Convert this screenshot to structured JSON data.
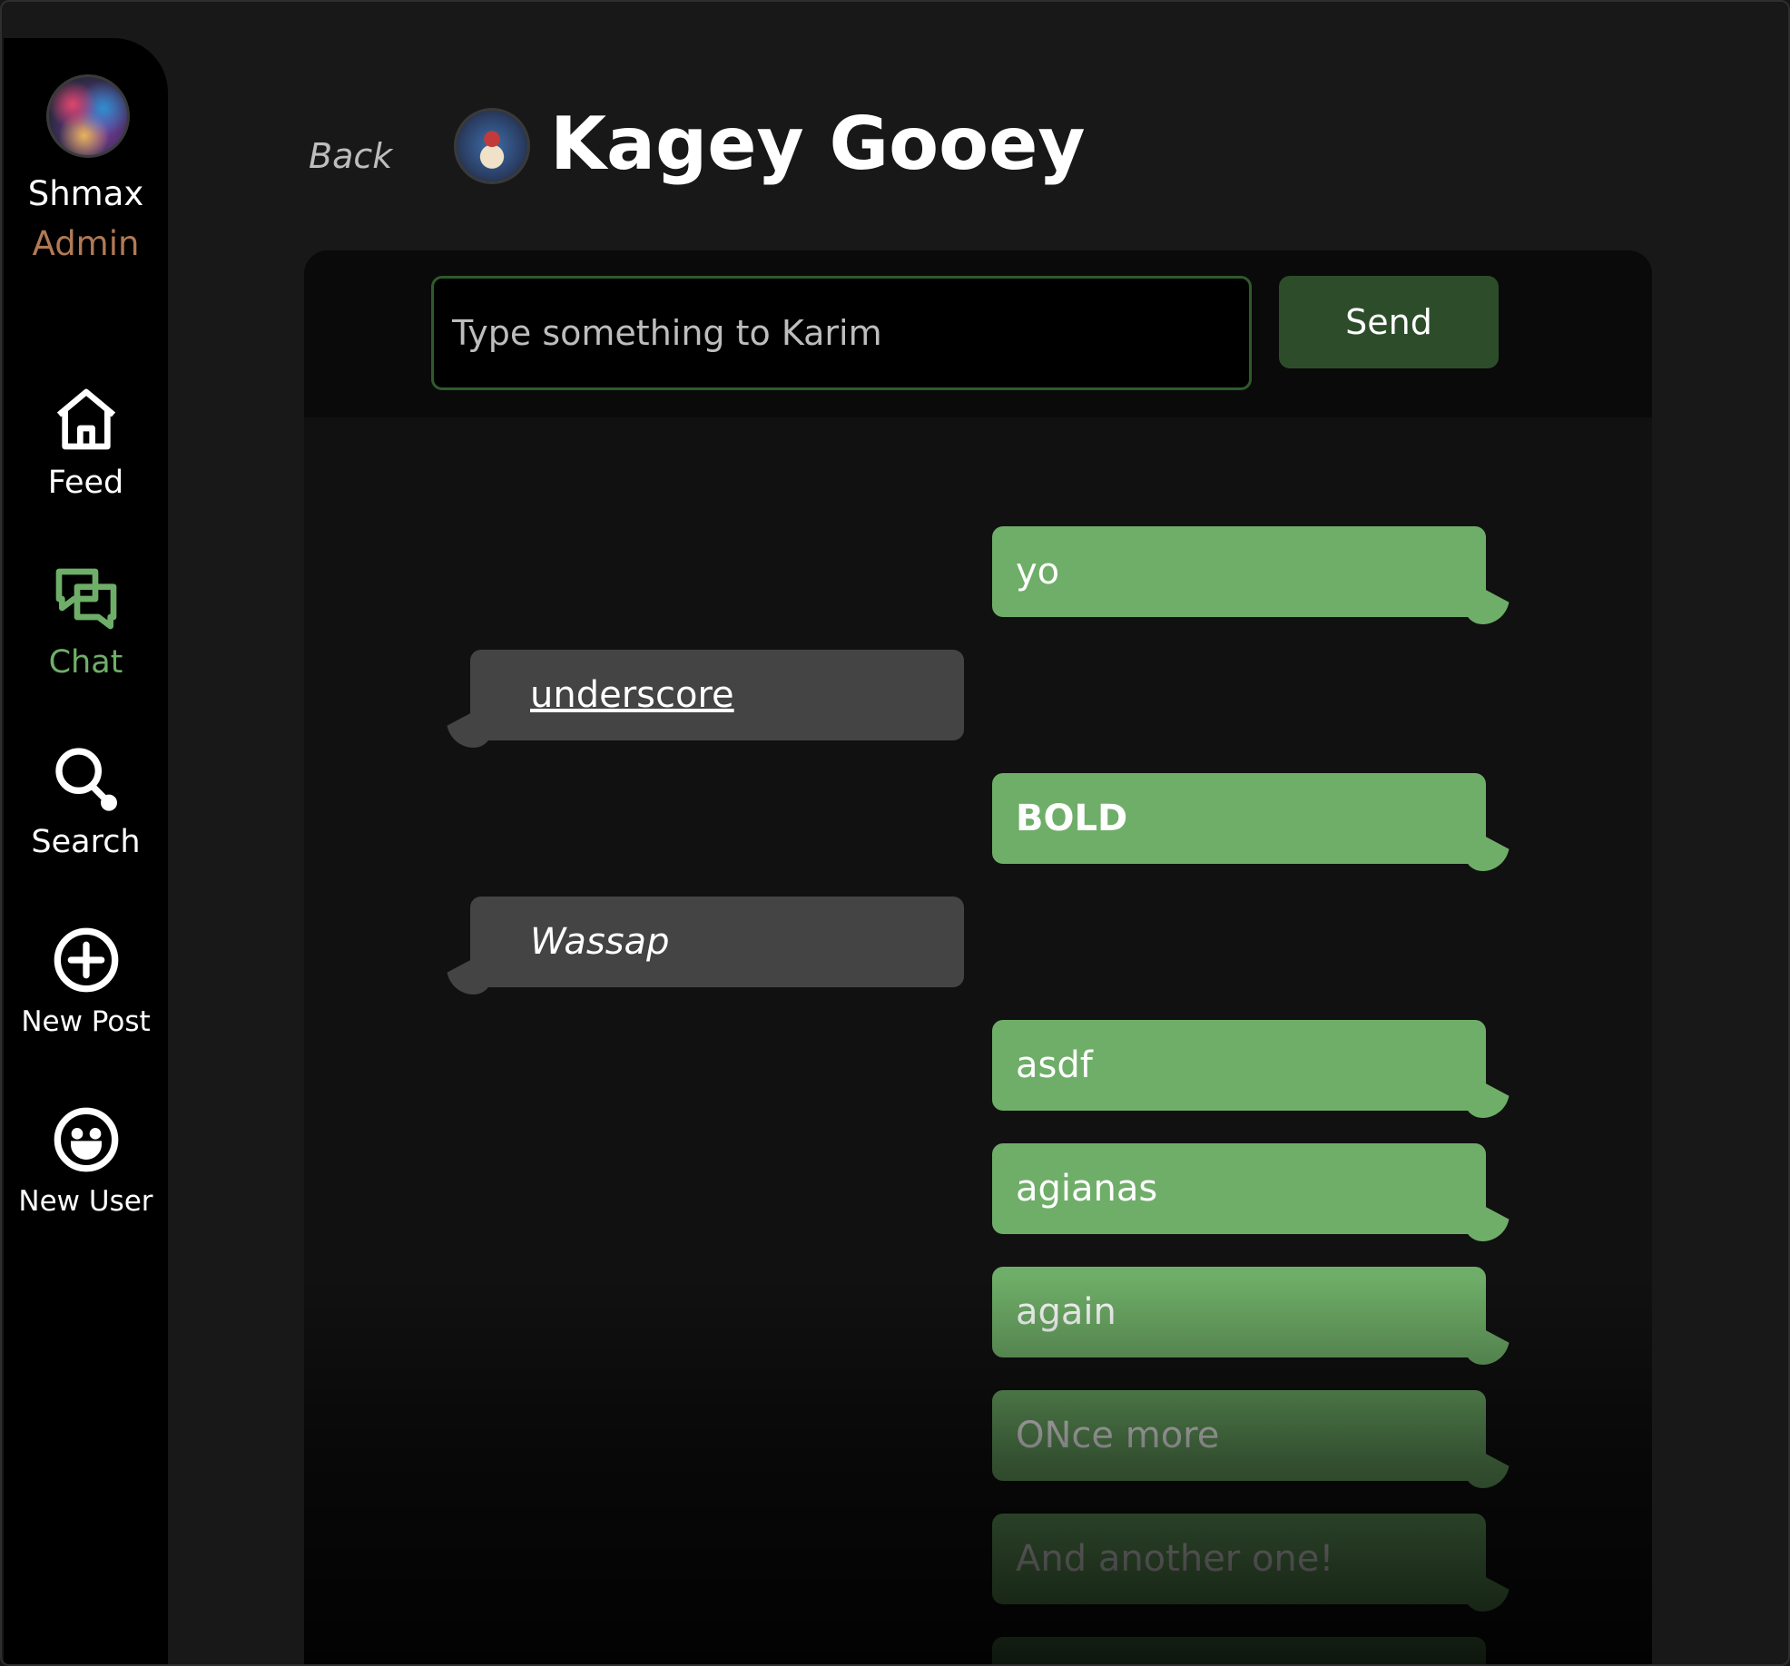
{
  "sidebar": {
    "profile": {
      "name": "Shmax",
      "role": "Admin"
    },
    "items": [
      {
        "label": "Feed",
        "icon": "home-icon",
        "active": false
      },
      {
        "label": "Chat",
        "icon": "chat-icon",
        "active": true
      },
      {
        "label": "Search",
        "icon": "search-icon",
        "active": false
      },
      {
        "label": "New Post",
        "icon": "plus-circle-icon",
        "active": false
      },
      {
        "label": "New User",
        "icon": "smiley-icon",
        "active": false
      }
    ]
  },
  "header": {
    "back_label": "Back",
    "contact_name": "Kagey Gooey"
  },
  "composer": {
    "placeholder": "Type something to Karim",
    "value": "",
    "send_label": "Send"
  },
  "messages": [
    {
      "text": "yo",
      "from": "me"
    },
    {
      "text": "underscore",
      "from": "them",
      "style": "underline"
    },
    {
      "text": "BOLD",
      "from": "me",
      "style": "bold"
    },
    {
      "text": "Wassap",
      "from": "them",
      "style": "italic"
    },
    {
      "text": "asdf",
      "from": "me"
    },
    {
      "text": "agianas",
      "from": "me"
    },
    {
      "text": "again",
      "from": "me"
    },
    {
      "text": "ONce more",
      "from": "me"
    },
    {
      "text": "And another one!",
      "from": "me"
    }
  ],
  "colors": {
    "accent": "#6fae68",
    "send_button": "#2d4d2a",
    "role": "#b07a55",
    "bubble_other": "#444444"
  }
}
